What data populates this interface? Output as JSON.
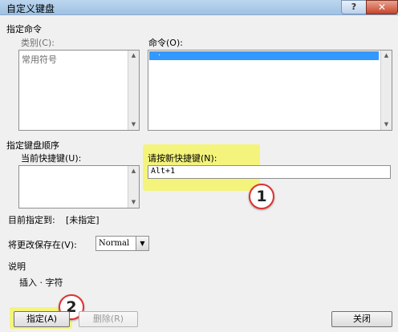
{
  "window": {
    "title": "自定义键盘",
    "help_label": "?",
    "close_label": "✕"
  },
  "commands_section": {
    "heading": "指定命令",
    "category_label": "类别(C):",
    "category_items": [
      "常用符号"
    ],
    "command_label": "命令(O):",
    "command_items": [
      "·"
    ]
  },
  "keyboard_section": {
    "heading": "指定键盘顺序",
    "current_keys_label": "当前快捷键(U):",
    "new_key_label": "请按新快捷键(N):",
    "new_key_value": "Alt+1",
    "currently_assigned_label": "目前指定到:",
    "currently_assigned_value": "[未指定]"
  },
  "save_in": {
    "label": "将更改保存在(V):",
    "value": "Normal"
  },
  "description": {
    "heading": "说明",
    "text": "插入 · 字符"
  },
  "buttons": {
    "assign": "指定(A)",
    "remove": "删除(R)",
    "close": "关闭"
  },
  "annotations": {
    "step1": "1",
    "step2": "2"
  },
  "colors": {
    "highlight": "#f4f47c",
    "selection": "#3399ff",
    "marker_border": "#dd3333"
  }
}
